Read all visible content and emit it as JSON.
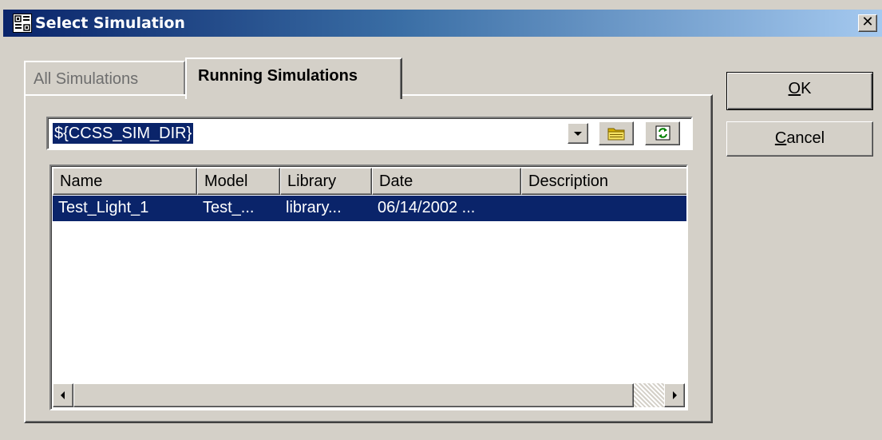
{
  "window": {
    "title": "Select Simulation",
    "close_glyph": "✕"
  },
  "tabs": [
    {
      "label": "All Simulations",
      "active": false
    },
    {
      "label": "Running Simulations",
      "active": true
    }
  ],
  "directory": {
    "value": "${CCSS_SIM_DIR}",
    "dropdown_icon": "triangle-down-icon",
    "folder_icon": "folder-icon",
    "refresh_icon": "refresh-icon"
  },
  "table": {
    "columns": [
      "Name",
      "Model",
      "Library",
      "Date",
      "Description"
    ],
    "rows": [
      {
        "name": "Test_Light_1",
        "model": "Test_...",
        "library": "library...",
        "date": "06/14/2002 ...",
        "description": ""
      }
    ]
  },
  "buttons": {
    "ok": {
      "mnemonic": "O",
      "rest": "K"
    },
    "cancel": {
      "mnemonic": "C",
      "rest": "ancel"
    }
  },
  "colors": {
    "selection": "#0a246a",
    "face": "#d4d0c8",
    "title_start": "#0a246a",
    "title_end": "#a6caf0"
  }
}
